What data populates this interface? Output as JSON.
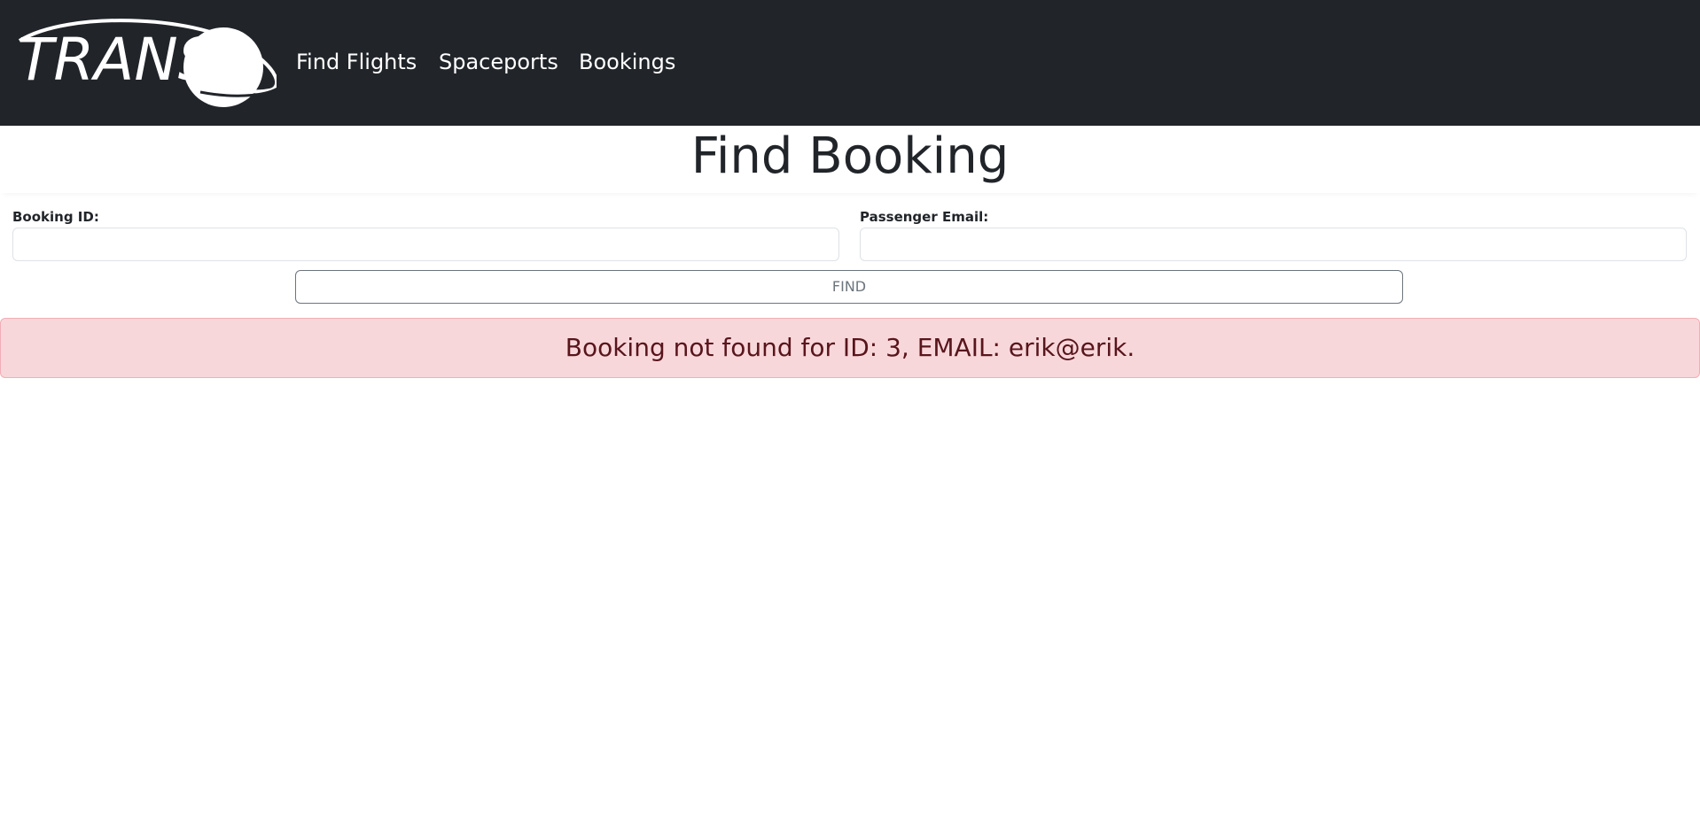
{
  "navbar": {
    "logo_text": "TRANS",
    "links": [
      {
        "label": "Find Flights"
      },
      {
        "label": "Spaceports"
      },
      {
        "label": "Bookings"
      }
    ]
  },
  "page": {
    "title": "Find Booking"
  },
  "form": {
    "booking_id": {
      "label": "Booking ID:",
      "value": "",
      "placeholder": ""
    },
    "passenger_email": {
      "label": "Passenger Email:",
      "value": "",
      "placeholder": ""
    },
    "find_button_label": "FIND"
  },
  "alert": {
    "message": "Booking not found for ID: 3, EMAIL: erik@erik."
  },
  "colors": {
    "navbar_bg": "#212529",
    "alert_bg": "#f8d7da",
    "alert_text": "#58151c",
    "button_border": "#6c757d"
  }
}
